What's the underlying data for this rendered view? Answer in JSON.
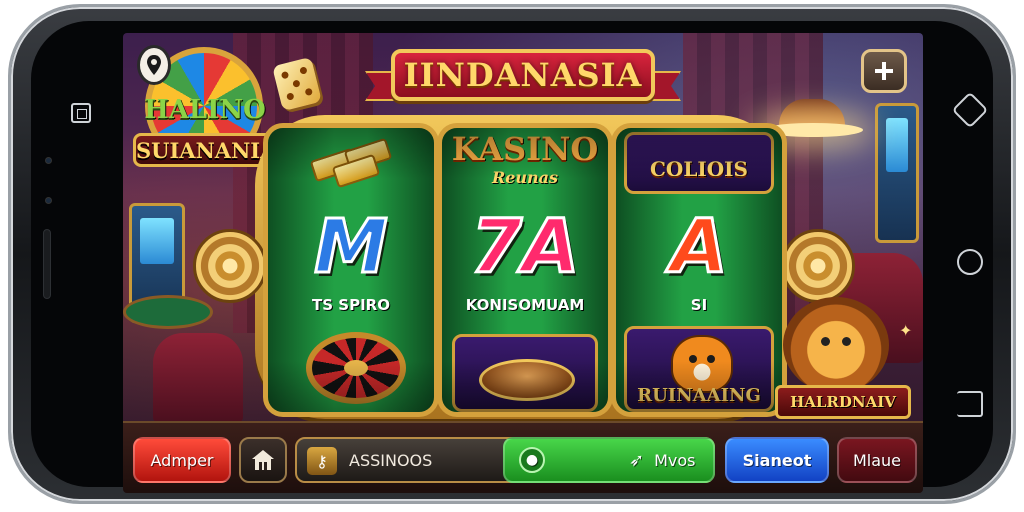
{
  "banner": {
    "title": "IINDANASIA"
  },
  "logo": {
    "line1": "HALINO",
    "line2": "SUIANANIAS"
  },
  "reels": {
    "left": {
      "symbol": "M",
      "caption": "TS SPIRO"
    },
    "middle": {
      "header": "KASINO",
      "subheader": "Reunas",
      "symbol": "7A",
      "caption": "KONISOMUAM"
    },
    "right": {
      "header": "COLIOIS",
      "symbol": "A",
      "caption": "SI",
      "footer": "RUINAAING"
    }
  },
  "lion_plate": "HALRDNAIV",
  "bottom_bar": {
    "red_button": "Admper",
    "field_text": "ASSINOOS",
    "green_button": "Mvos",
    "blue_button": "Sianeot",
    "maroon_button": "Mlaue"
  },
  "icons": [
    "pin-icon",
    "plus-icon",
    "house-icon",
    "key-icon",
    "bet-icon",
    "arrow-icon",
    "dice-icon"
  ],
  "colors": {
    "accent_gold": "#f2c85b",
    "reel_green": "#22a145",
    "banner_red": "#d8243d",
    "blue": "#1242c4"
  }
}
